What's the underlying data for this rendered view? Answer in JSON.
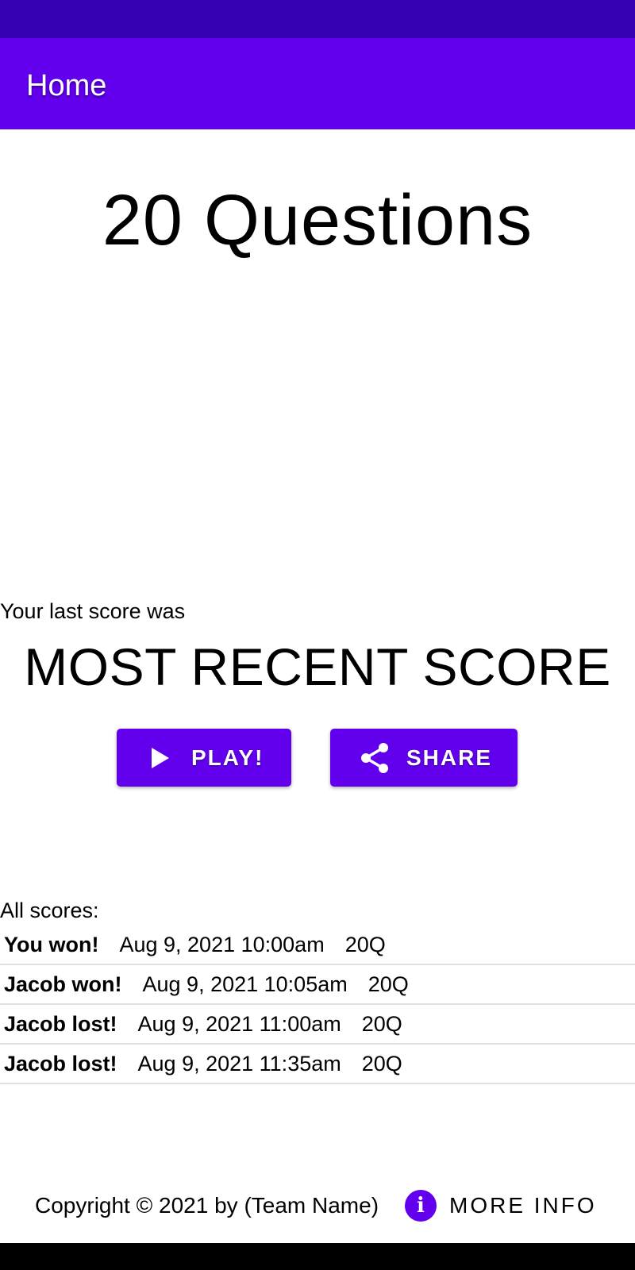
{
  "app_bar": {
    "title": "Home"
  },
  "main": {
    "game_title": "20 Questions",
    "last_score_label": "Your last score was",
    "recent_score": "MOST RECENT SCORE",
    "play_button": {
      "label": "PLAY!",
      "icon": "play-icon"
    },
    "share_button": {
      "label": "SHARE",
      "icon": "share-icon"
    }
  },
  "scores": {
    "label": "All scores:",
    "rows": [
      {
        "result": "You won!",
        "date": "Aug 9, 2021 10:00am",
        "game": "20Q"
      },
      {
        "result": "Jacob won!",
        "date": "Aug 9, 2021 10:05am",
        "game": "20Q"
      },
      {
        "result": "Jacob lost!",
        "date": "Aug 9, 2021 11:00am",
        "game": "20Q"
      },
      {
        "result": "Jacob lost!",
        "date": "Aug 9, 2021 11:35am",
        "game": "20Q"
      }
    ]
  },
  "footer": {
    "copyright": "Copyright © 2021 by (Team Name)",
    "info_icon_glyph": "i",
    "more_info_label": "MORE INFO"
  },
  "colors": {
    "status_bar": "#3700b3",
    "primary": "#6200ee",
    "divider": "#e0e0e0"
  }
}
